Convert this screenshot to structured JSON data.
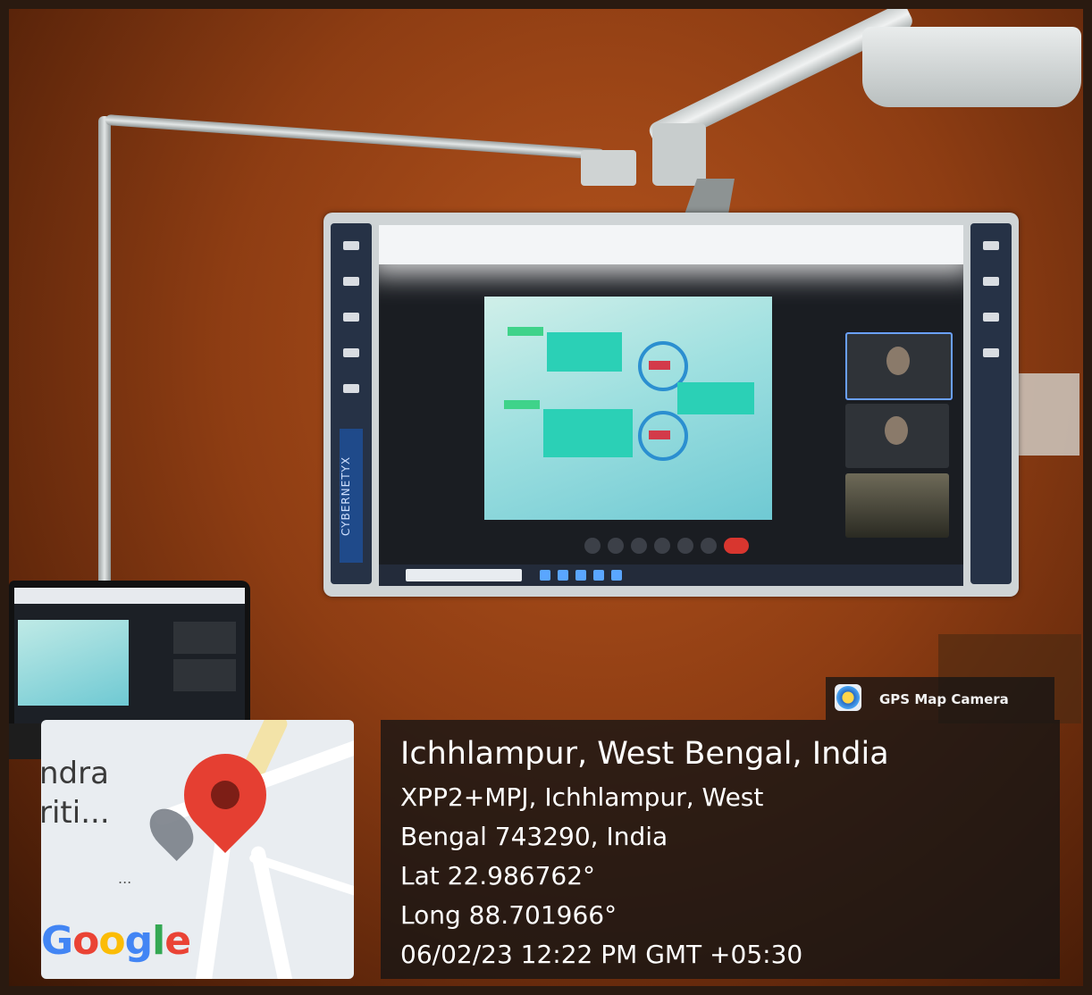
{
  "board": {
    "brand": "CYBERNETYX"
  },
  "badge": {
    "label": "GPS Map Camera",
    "logo_icon": "gps-camera-icon"
  },
  "map": {
    "place_line1": "ndra",
    "place_line2": "riti...",
    "dots": "...",
    "google_letters": [
      "G",
      "o",
      "o",
      "g",
      "l",
      "e"
    ]
  },
  "location": {
    "title": "Ichhlampur, West Bengal, India",
    "address_line1": "XPP2+MPJ, Ichhlampur, West",
    "address_line2": "Bengal 743290, India",
    "lat": "Lat 22.986762°",
    "long": "Long 88.701966°",
    "datetime": "06/02/23 12:22 PM GMT +05:30"
  },
  "colors": {
    "wall": "#8e3d13",
    "pin": "#e53f32",
    "overlay": "#141414"
  }
}
